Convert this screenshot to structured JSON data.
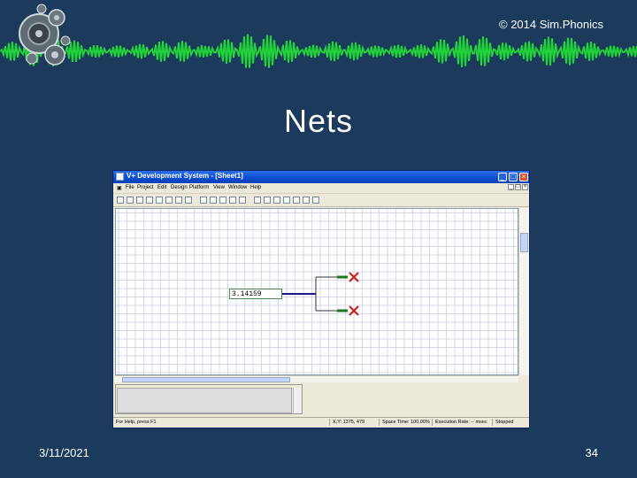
{
  "slide": {
    "copyright": "© 2014 Sim.Phonics",
    "title": "Nets",
    "date": "3/11/2021",
    "page": "34"
  },
  "window": {
    "title": "V+ Development System - [Sheet1]",
    "menu": [
      "File",
      "Project",
      "Edit",
      "Design",
      "Platform",
      "View",
      "Window",
      "Help"
    ],
    "toolbar_icons": [
      "new-icon",
      "open-icon",
      "save-icon",
      "cut-icon",
      "copy-icon",
      "paste-icon",
      "print-icon",
      "find-icon",
      "zoom-icon",
      "select-icon",
      "rotate-icon",
      "delete-icon",
      "align-icon",
      "run-icon",
      "stop-icon",
      "pause-icon",
      "step-icon",
      "settings-icon",
      "link-icon",
      "palette-icon"
    ],
    "value_box": "3.14159",
    "status": {
      "help": "For Help, press F1",
      "xy": "X,Y: 1375, 479",
      "space_time": "Space Time: 100.00%",
      "exec_rate": "Execution Rate: -- msec",
      "state": "Stopped"
    },
    "colors": {
      "wire_green": "#1a7a1a",
      "wire_blue": "#1a1a8a",
      "x_red": "#d11a1a"
    }
  }
}
